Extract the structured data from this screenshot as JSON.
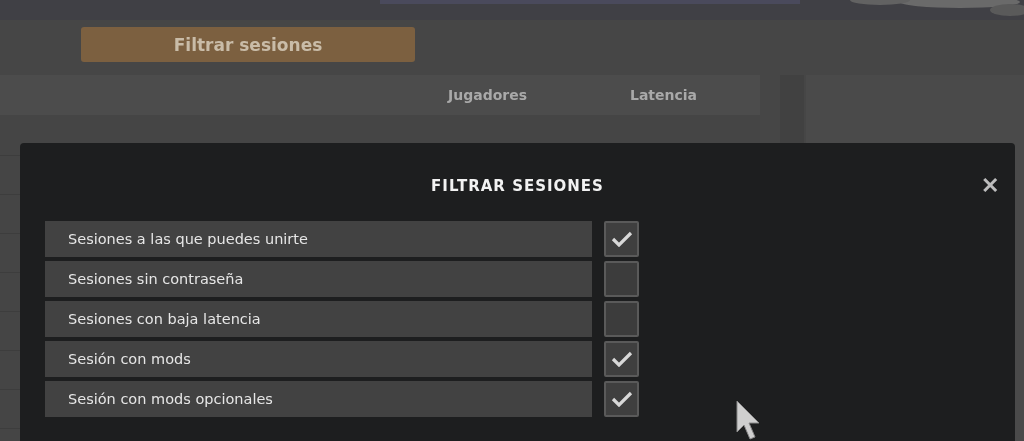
{
  "filter_button": {
    "label": "Filtrar sesiones"
  },
  "table": {
    "columns": [
      "Jugadores",
      "Latencia"
    ]
  },
  "dialog": {
    "title": "FILTRAR SESIONES",
    "close": "✕",
    "options": [
      {
        "label": "Sesiones a las que puedes unirte",
        "checked": true
      },
      {
        "label": "Sesiones sin contraseña",
        "checked": false
      },
      {
        "label": "Sesiones con baja latencia",
        "checked": false
      },
      {
        "label": "Sesión con mods",
        "checked": true
      },
      {
        "label": "Sesión con mods opcionales",
        "checked": true
      }
    ]
  }
}
